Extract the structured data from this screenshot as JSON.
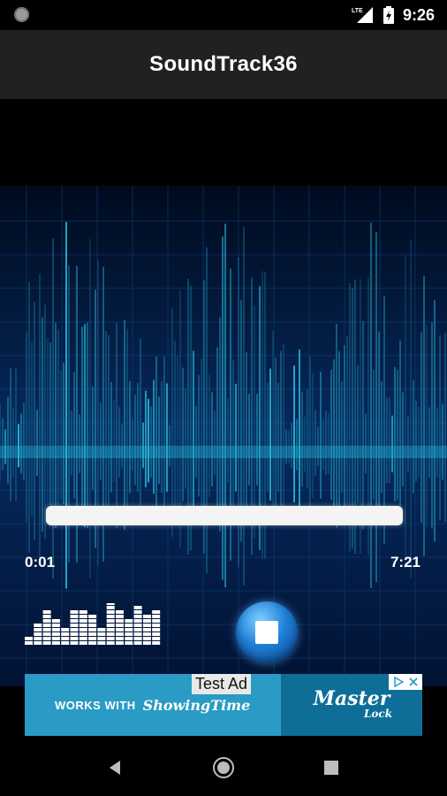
{
  "status_bar": {
    "time": "9:26",
    "network_label": "LTE",
    "icons": [
      "circle-notification-icon",
      "lte-signal-icon",
      "battery-icon"
    ]
  },
  "app_bar": {
    "title": "SoundTrack36"
  },
  "player": {
    "progress": 0.0,
    "current_time": "0:01",
    "total_time": "7:21",
    "equalizer_icon": "equalizer-icon",
    "stop_icon": "stop-icon"
  },
  "ad": {
    "test_label": "Test Ad",
    "works_with": "WORKS WITH",
    "partner": "ShowingTime",
    "brand_top": "Master",
    "brand_bottom": "Lock",
    "choices_icon": "ad-choices-icon"
  },
  "nav": {
    "icons": [
      "back-icon",
      "home-icon",
      "recents-icon"
    ]
  },
  "colors": {
    "app_bar": "#212121",
    "wave": "#29c4e6",
    "ad_background": "#2a9bc5",
    "stop_button": "#1e7fd6"
  }
}
